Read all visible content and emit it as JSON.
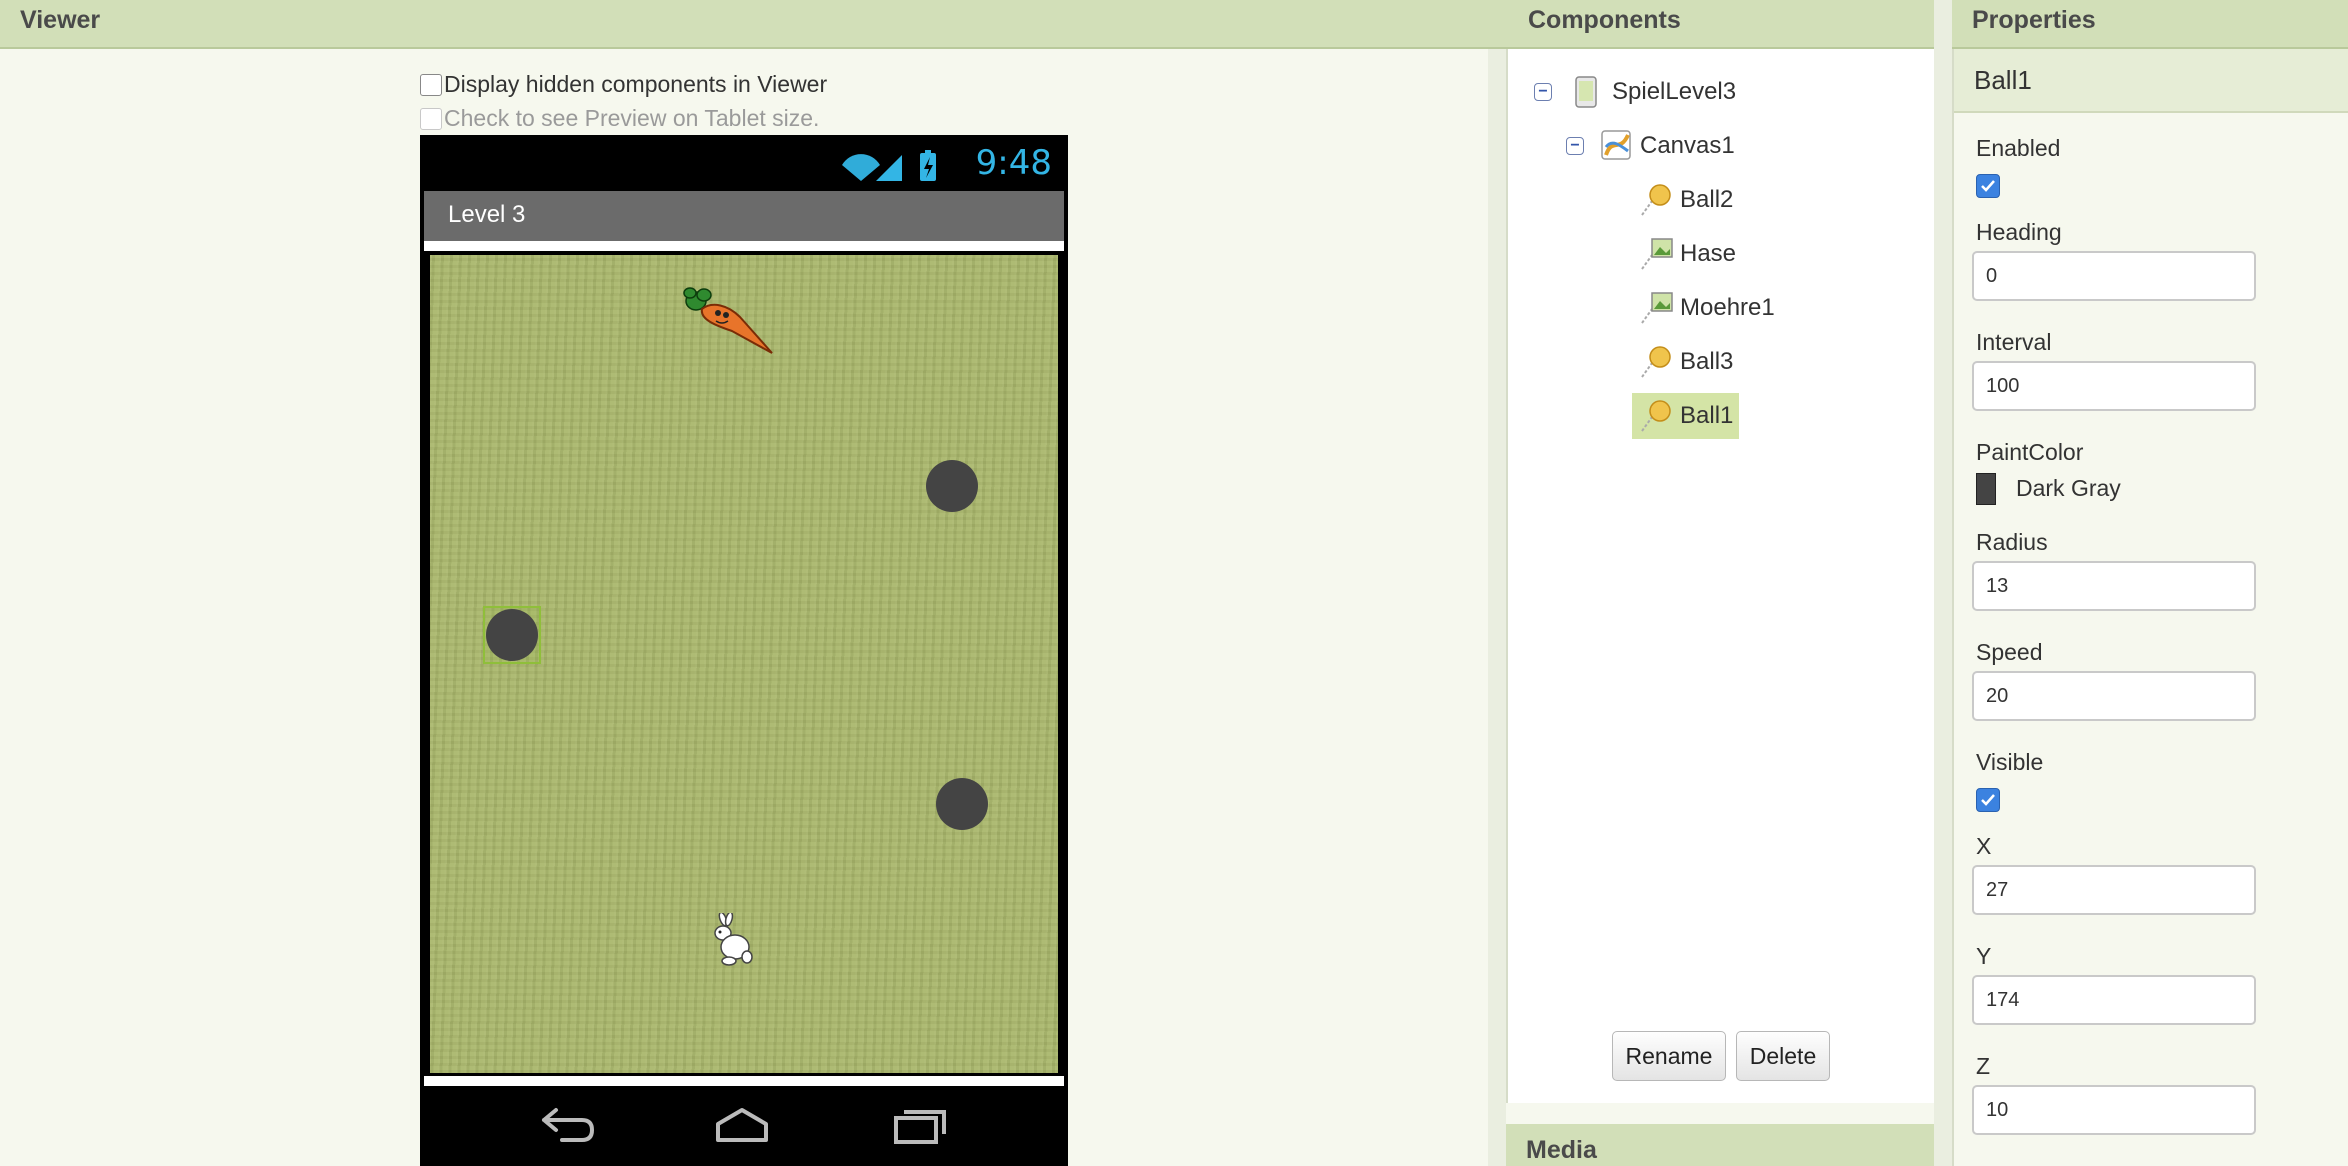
{
  "viewer": {
    "header": "Viewer",
    "hidden_checkbox_label": "Display hidden components in Viewer",
    "tablet_checkbox_label": "Check to see Preview on Tablet size.",
    "phone": {
      "time": "9:48",
      "title": "Level 3"
    }
  },
  "components": {
    "header": "Components",
    "tree": [
      {
        "label": "SpielLevel3",
        "icon": "screen-icon"
      },
      {
        "label": "Canvas1",
        "icon": "canvas-icon"
      },
      {
        "label": "Ball2",
        "icon": "ball-icon"
      },
      {
        "label": "Hase",
        "icon": "imagesprite-icon"
      },
      {
        "label": "Moehre1",
        "icon": "imagesprite-icon"
      },
      {
        "label": "Ball3",
        "icon": "ball-icon"
      },
      {
        "label": "Ball1",
        "icon": "ball-icon",
        "selected": true
      }
    ],
    "rename_label": "Rename",
    "delete_label": "Delete",
    "media_header": "Media"
  },
  "properties": {
    "header": "Properties",
    "component_name": "Ball1",
    "enabled_label": "Enabled",
    "enabled": true,
    "heading_label": "Heading",
    "heading_value": "0",
    "interval_label": "Interval",
    "interval_value": "100",
    "paintcolor_label": "PaintColor",
    "paintcolor_value": "Dark Gray",
    "paintcolor_hex": "#444444",
    "radius_label": "Radius",
    "radius_value": "13",
    "speed_label": "Speed",
    "speed_value": "20",
    "visible_label": "Visible",
    "visible": true,
    "x_label": "X",
    "x_value": "27",
    "y_label": "Y",
    "y_value": "174",
    "z_label": "Z",
    "z_value": "10"
  },
  "colors": {
    "header_bg": "#d2dfb8",
    "canvas_bg": "#a9b76b",
    "ball": "#444444",
    "selection": "#d4e4a6",
    "status_blue": "#33b5e5"
  }
}
